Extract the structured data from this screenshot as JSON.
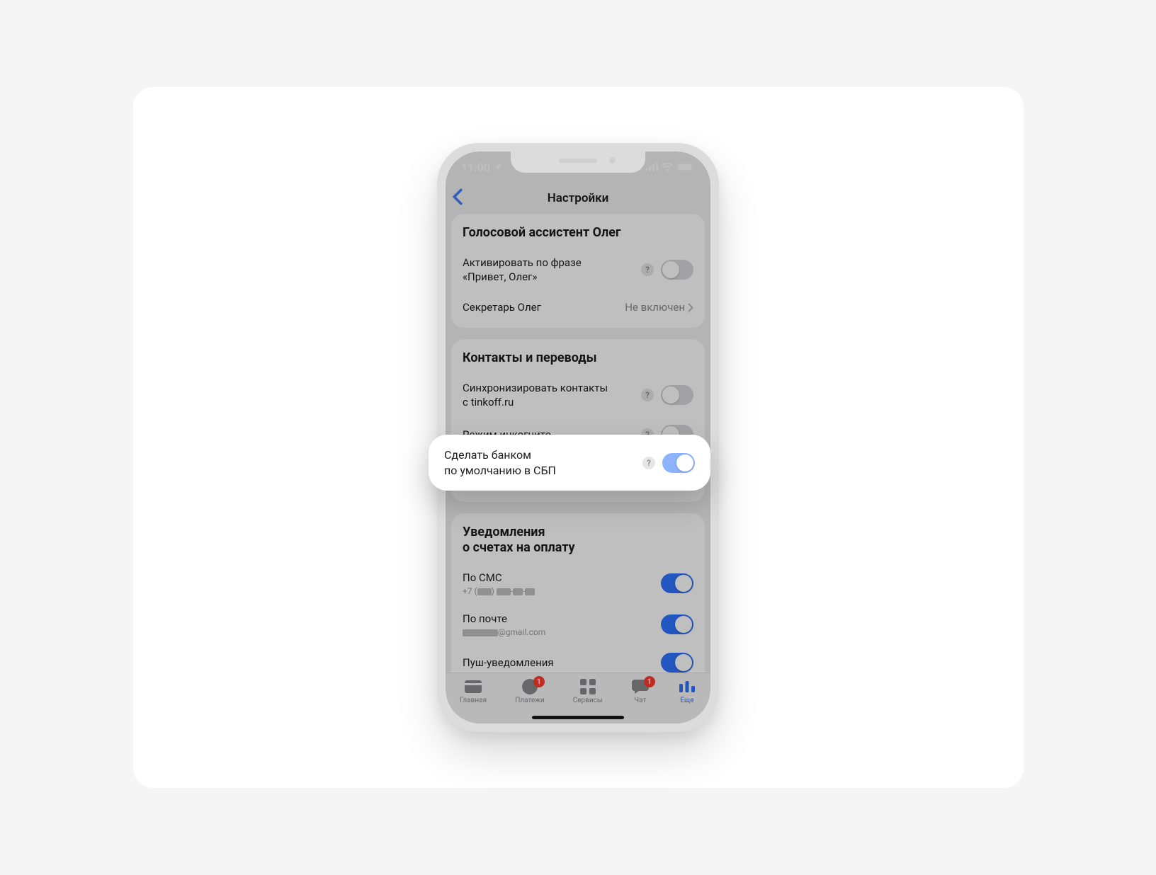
{
  "status": {
    "time": "11:00"
  },
  "nav": {
    "title": "Настройки"
  },
  "groups": {
    "assistant": {
      "title": "Голосовой ассистент Олег",
      "activate_label": "Активировать по фразе\n«Привет, Олег»",
      "secretary_label": "Секретарь Олег",
      "secretary_value": "Не включен"
    },
    "contacts": {
      "title": "Контакты и переводы",
      "sync_label": "Синхронизировать контакты\nс tinkoff.ru",
      "incognito_label": "Режим инкогнито",
      "sbp_label": "Сделать банком\nпо умолчанию в СБП"
    },
    "notifications": {
      "title": "Уведомления\nо счетах на оплату",
      "sms_label": "По СМС",
      "sms_sub_prefix": "+7 (",
      "email_label": "По почте",
      "email_sub_suffix": "@gmail.com",
      "push_label": "Пуш-уведомления"
    }
  },
  "tabs": {
    "home": "Главная",
    "payments": "Платежи",
    "services": "Сервисы",
    "chat": "Чат",
    "more": "Еще",
    "payments_badge": "1",
    "chat_badge": "1"
  },
  "help_char": "?"
}
